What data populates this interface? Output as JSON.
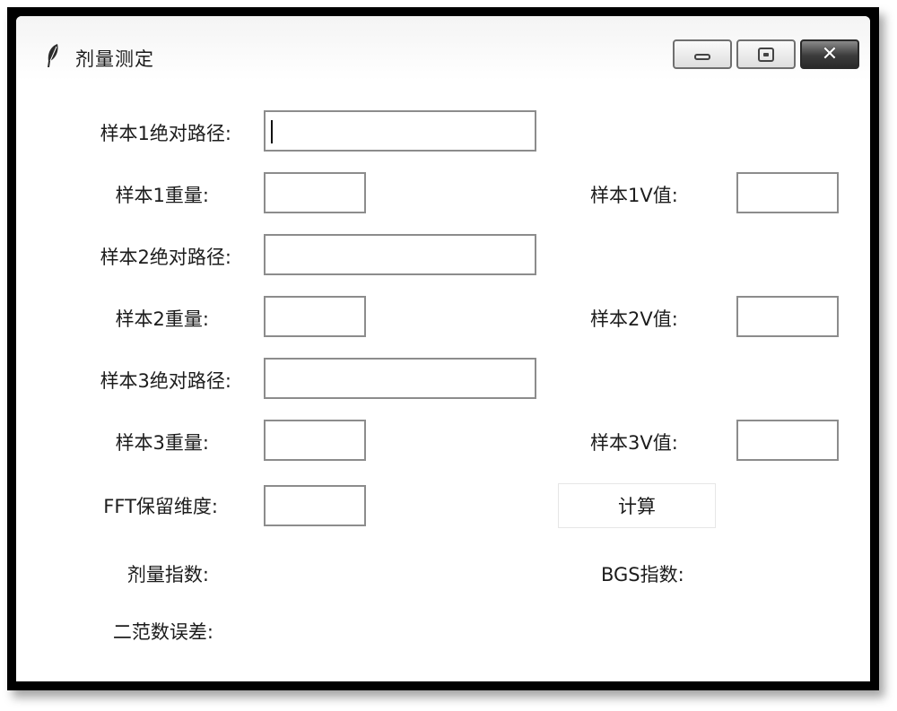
{
  "window": {
    "title": "剂量测定",
    "icon": "feather-icon",
    "controls": {
      "minimize": "minimize-icon",
      "maximize": "maximize-icon",
      "close": "close-icon",
      "close_glyph": "✕"
    }
  },
  "form": {
    "sample1_path_label": "样本1绝对路径:",
    "sample1_path_value": "",
    "sample1_weight_label": "样本1重量:",
    "sample1_weight_value": "",
    "sample1_v_label": "样本1V值:",
    "sample1_v_value": "",
    "sample2_path_label": "样本2绝对路径:",
    "sample2_path_value": "",
    "sample2_weight_label": "样本2重量:",
    "sample2_weight_value": "",
    "sample2_v_label": "样本2V值:",
    "sample2_v_value": "",
    "sample3_path_label": "样本3绝对路径:",
    "sample3_path_value": "",
    "sample3_weight_label": "样本3重量:",
    "sample3_weight_value": "",
    "sample3_v_label": "样本3V值:",
    "sample3_v_value": "",
    "fft_dim_label": "FFT保留维度:",
    "fft_dim_value": "",
    "calculate_button": "计算"
  },
  "results": {
    "dose_index_label": "剂量指数:",
    "bgs_index_label": "BGS指数:",
    "norm2_error_label": "二范数误差:"
  }
}
